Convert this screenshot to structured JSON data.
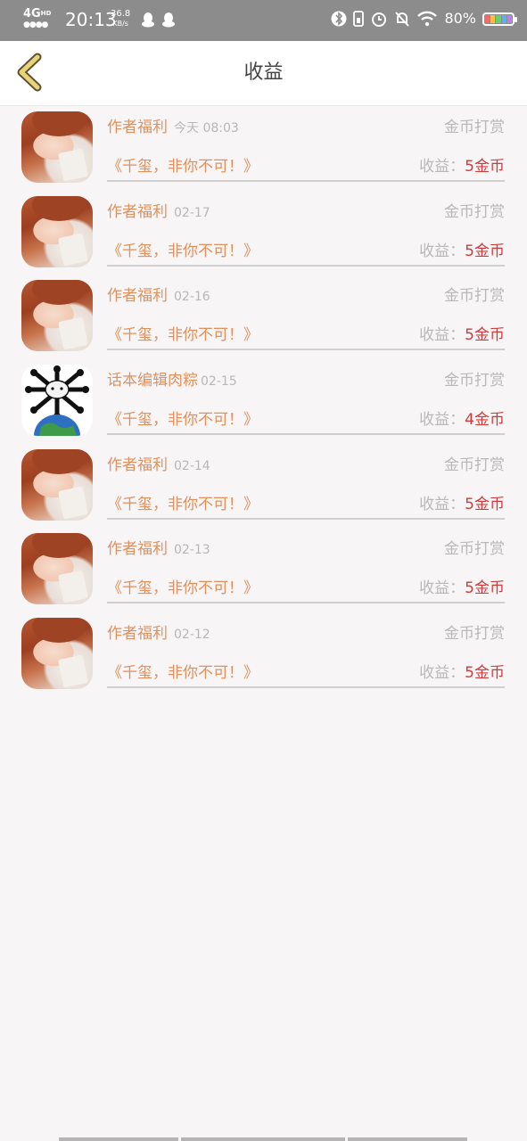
{
  "status_bar": {
    "network": "4G",
    "network_sup": "HD",
    "time": "20:13",
    "speed_value": "36.8",
    "speed_unit": "KB/s",
    "battery_percent": "80%"
  },
  "header": {
    "title": "收益",
    "back_icon": "chevron-left-icon"
  },
  "records": [
    {
      "avatar": "girl",
      "name": "作者福利",
      "date": "今天 08:03",
      "type": "金币打赏",
      "book": "《千玺，非你不可！》",
      "income_label": "收益：",
      "income_value": "5金币"
    },
    {
      "avatar": "girl",
      "name": "作者福利",
      "date": "02-17",
      "type": "金币打赏",
      "book": "《千玺，非你不可！》",
      "income_label": "收益：",
      "income_value": "5金币"
    },
    {
      "avatar": "girl",
      "name": "作者福利",
      "date": "02-16",
      "type": "金币打赏",
      "book": "《千玺，非你不可！》",
      "income_label": "收益：",
      "income_value": "5金币"
    },
    {
      "avatar": "earth",
      "name": "话本编辑肉粽",
      "date": "02-15",
      "type": "金币打赏",
      "book": "《千玺，非你不可！》",
      "income_label": "收益：",
      "income_value": "4金币"
    },
    {
      "avatar": "girl",
      "name": "作者福利",
      "date": "02-14",
      "type": "金币打赏",
      "book": "《千玺，非你不可！》",
      "income_label": "收益：",
      "income_value": "5金币"
    },
    {
      "avatar": "girl",
      "name": "作者福利",
      "date": "02-13",
      "type": "金币打赏",
      "book": "《千玺，非你不可！》",
      "income_label": "收益：",
      "income_value": "5金币"
    },
    {
      "avatar": "girl",
      "name": "作者福利",
      "date": "02-12",
      "type": "金币打赏",
      "book": "《千玺，非你不可！》",
      "income_label": "收益：",
      "income_value": "5金币"
    }
  ],
  "colors": {
    "accent_orange": "#e0915d",
    "income_red": "#d13a3a",
    "muted_gray": "#b8b8b8",
    "back_arrow": "#e8d37a"
  }
}
